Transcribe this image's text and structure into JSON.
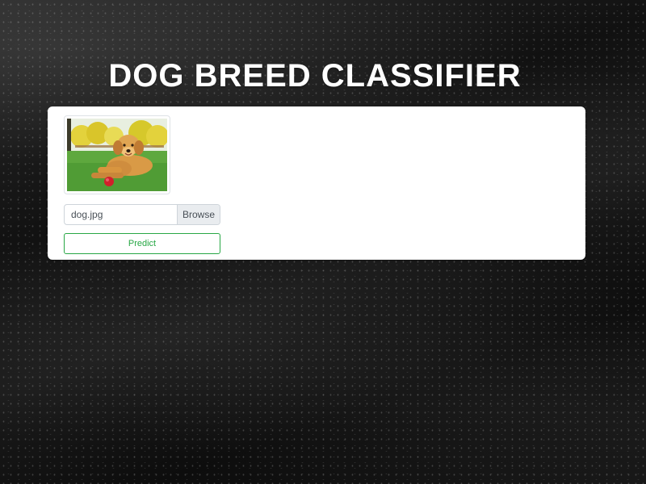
{
  "page": {
    "title": "DOG BREED CLASSIFIER"
  },
  "upload": {
    "preview_image": "golden-retriever-photo",
    "file_name": "dog.jpg",
    "browse_label": "Browse"
  },
  "actions": {
    "predict_label": "Predict"
  },
  "colors": {
    "background": "#0b0b0b",
    "card": "#ffffff",
    "accent_green": "#28a745",
    "input_border": "#ced4da",
    "browse_bg": "#e9ecef"
  }
}
